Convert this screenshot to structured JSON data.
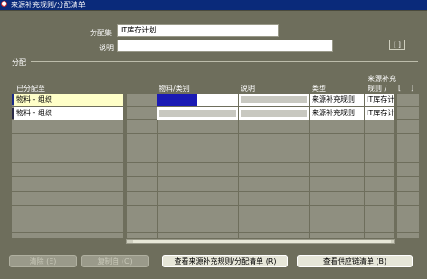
{
  "window": {
    "title": "来源补充规则/分配清单"
  },
  "header": {
    "assignment_set_label": "分配集",
    "assignment_set_value": "IT库存计划",
    "description_label": "说明",
    "description_value": "",
    "context_button": "[ ]"
  },
  "section": {
    "title": "分配"
  },
  "grid": {
    "columns": {
      "assigned_to": "已分配至",
      "item_category": "物料/类别",
      "description": "说明",
      "type": "类型",
      "source_rule_top": "来源补充",
      "source_rule_bottom": "规则 /",
      "flex_open": "[",
      "flex_close": "]"
    },
    "rows": [
      {
        "assigned_to": "物料 - 组织",
        "item": "",
        "description": "",
        "type": "来源补充规则",
        "source_rule": "IT库存计划"
      },
      {
        "assigned_to": "物料 - 组织",
        "item": "",
        "description": "",
        "type": "来源补充规则",
        "source_rule": "IT库存计划"
      }
    ]
  },
  "buttons": {
    "clear": "清除 (E)",
    "copy_from": "复制自 (C)",
    "view_rules": "查看来源补充规则/分配清单 (R)",
    "view_supply_chain": "查看供应链清单 (B)"
  },
  "colors": {
    "background": "#6e6e5c",
    "title_bar": "#0a2a7a",
    "current_row": "#ffffc8",
    "selection": "#1a1ab4"
  }
}
